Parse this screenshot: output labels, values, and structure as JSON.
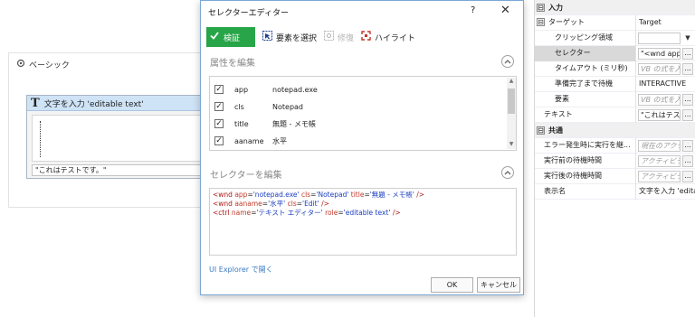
{
  "designer": {
    "sequence_title": "ベーシック",
    "activity_title": "文字を入力 'editable text'",
    "activity_input_value": "\"これはテストです。\""
  },
  "dialog": {
    "title": "セレクターエディター",
    "help": "?",
    "close": "✕",
    "toolbar": {
      "validate": "検証",
      "select_element": "要素を選択",
      "repair": "修復",
      "highlight": "ハイライト"
    },
    "attributes_heading": "属性を編集",
    "attributes": [
      {
        "name": "app",
        "value": "notepad.exe",
        "checked": true
      },
      {
        "name": "cls",
        "value": "Notepad",
        "checked": true
      },
      {
        "name": "title",
        "value": "無題 - メモ帳",
        "checked": true
      },
      {
        "name": "aaname",
        "value": "水平",
        "checked": true
      }
    ],
    "selector_heading": "セレクターを編集",
    "selector_lines": [
      {
        "tag": "<wnd",
        "attrs": [
          {
            "n": "app",
            "v": "'notepad.exe'"
          },
          {
            "n": "cls",
            "v": "'Notepad'"
          },
          {
            "n": "title",
            "v": "'無題 - メモ帳'"
          }
        ],
        "end": "/>"
      },
      {
        "tag": "<wnd",
        "attrs": [
          {
            "n": "aaname",
            "v": "'水平'"
          },
          {
            "n": "cls",
            "v": "'Edit'"
          }
        ],
        "end": "/>"
      },
      {
        "tag": "<ctrl",
        "attrs": [
          {
            "n": "name",
            "v": "'テキスト エディター'"
          },
          {
            "n": "role",
            "v": "'editable text'"
          }
        ],
        "end": "/>"
      }
    ],
    "ui_explorer_link": "UI Explorer で開く",
    "ok": "OK",
    "cancel": "キャンセル"
  },
  "properties": {
    "cat_input": "入力",
    "target": "ターゲット",
    "target_value": "Target",
    "clipping": "クリッピング領域",
    "selector": "セレクター",
    "selector_value": "\"<wnd app",
    "timeout": "タイムアウト (ミリ秒)",
    "timeout_hint": "VB の式を入",
    "wait_ready": "準備完了まで待機",
    "wait_ready_value": "INTERACTIVE",
    "element": "要素",
    "element_hint": "VB の式を入",
    "text": "テキスト",
    "text_value": "\"これはテスト",
    "cat_common": "共通",
    "continue_on_error": "エラー発生時に実行を継...",
    "continue_on_error_hint": "現在のアクテ",
    "delay_before": "実行前の待機時間",
    "delay_before_hint": "アクティビティ",
    "delay_after": "実行後の待機時間",
    "delay_after_hint": "アクティビティ",
    "display_name": "表示名",
    "display_name_value": "文字を入力 'editab",
    "ellipsis": "...",
    "expander": "⊟",
    "dropdown_arrow": "▼"
  },
  "colors": {
    "validate_bg": "#28a548",
    "activity_header": "#cfe3f6",
    "selector_tag": "#b01515",
    "selector_value": "#1b3fbf",
    "link": "#3a78c2"
  }
}
